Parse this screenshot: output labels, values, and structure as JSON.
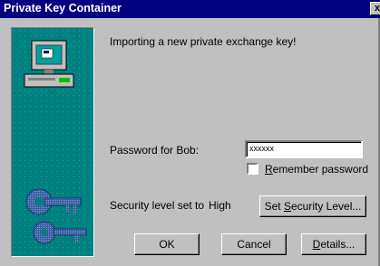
{
  "window": {
    "title": "Private Key Container",
    "close_glyph": "x"
  },
  "message": "Importing a new private exchange key!",
  "password": {
    "label": "Password for Bob:",
    "value": "xxxxxx"
  },
  "remember": {
    "accel": "R",
    "rest": "emember password",
    "checked": false
  },
  "security": {
    "label": "Security level set to",
    "level": "High"
  },
  "buttons": {
    "set_security": {
      "pre": "Set ",
      "accel": "S",
      "post": "ecurity Level..."
    },
    "ok": {
      "label": "OK"
    },
    "cancel": {
      "label": "Cancel"
    },
    "details": {
      "accel": "D",
      "post": "etails..."
    }
  },
  "icons": [
    "computer-icon",
    "keys-icon"
  ],
  "colors": {
    "title_bar": "#000080",
    "face": "#c0c0c0",
    "art_teal": "#008080"
  }
}
